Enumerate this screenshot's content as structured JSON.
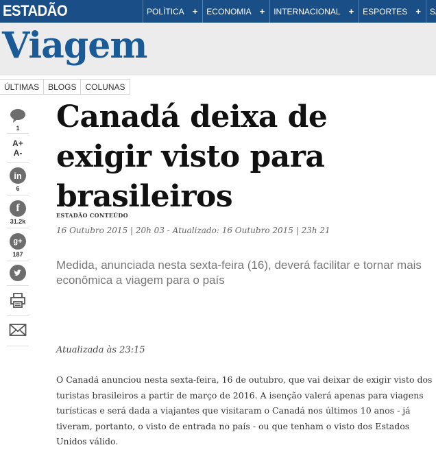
{
  "topbar": {
    "brand": "ESTADÃO",
    "nav": [
      {
        "label": "POLÍTICA",
        "plus": "+"
      },
      {
        "label": "ECONOMIA",
        "plus": "+"
      },
      {
        "label": "INTERNACIONAL",
        "plus": "+"
      },
      {
        "label": "ESPORTES",
        "plus": "+"
      },
      {
        "label": "SÃO PAU",
        "plus": ""
      }
    ]
  },
  "section": {
    "title": "Viagem",
    "subnav": [
      "ÚLTIMAS",
      "BLOGS",
      "COLUNAS"
    ]
  },
  "share": {
    "comments_count": "1",
    "font_increase": "A+",
    "font_decrease": "A-",
    "linkedin_letter": "in",
    "linkedin_count": "6",
    "facebook_letter": "f",
    "facebook_count": "31.2k",
    "googleplus_letter": "g+",
    "googleplus_count": "187"
  },
  "article": {
    "headline": "Canadá deixa de exigir visto para brasileiros",
    "byline": "ESTADÃO CONTEÚDO",
    "dateline": "16 Outubro 2015 | 20h 03 - Atualizado: 16 Outubro 2015 | 23h 21",
    "deck": "Medida, anunciada nesta sexta-feira (16), deverá facilitar e tornar mais econômica a viagem para o país",
    "updated": "Atualizada às 23:15",
    "body": "O Canadá anunciou nesta sexta-feira, 16 de outubro, que vai deixar de exigir visto dos turistas brasileiros a partir de março de 2016. A isenção valerá apenas para viagens turísticas e será dada a viajantes que visitaram o Canadá nos últimos 10 anos  - já tiveram, portanto, o visto de entrada no país - ou que tenham o visto dos Estados Unidos válido."
  },
  "colors": {
    "topbar": "#1a4e86",
    "section_title": "#1a5a97",
    "share_icon": "#6d6d6d"
  }
}
